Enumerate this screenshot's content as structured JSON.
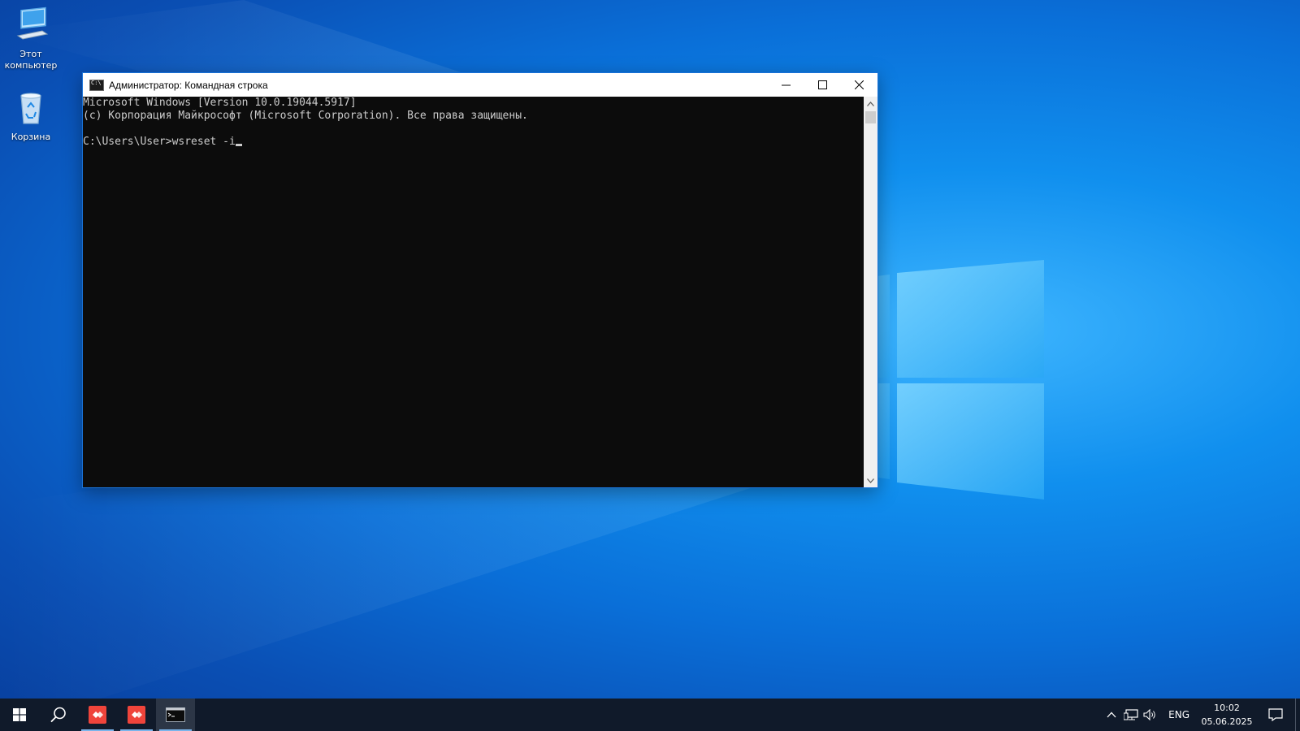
{
  "desktop": {
    "icons": [
      {
        "label": "Этот\nкомпьютер",
        "icon": "this-pc-icon"
      },
      {
        "label": "Корзина",
        "icon": "recycle-bin-icon"
      }
    ]
  },
  "window": {
    "title": "Администратор: Командная строка",
    "console_lines": [
      "Microsoft Windows [Version 10.0.19044.5917]",
      "(c) Корпорация Майкрософт (Microsoft Corporation). Все права защищены.",
      "",
      "C:\\Users\\User>wsreset -i"
    ]
  },
  "taskbar": {
    "language": "ENG",
    "time": "10:02",
    "date": "05.06.2025",
    "apps": [
      {
        "name": "anydesk-icon",
        "active": false
      },
      {
        "name": "anydesk-icon",
        "active": false
      },
      {
        "name": "cmd-icon",
        "active": true
      }
    ]
  },
  "colors": {
    "console_bg": "#0c0c0c",
    "console_fg": "#cccccc",
    "taskbar_bg": "#101a2a",
    "accent": "#1a73d9"
  }
}
